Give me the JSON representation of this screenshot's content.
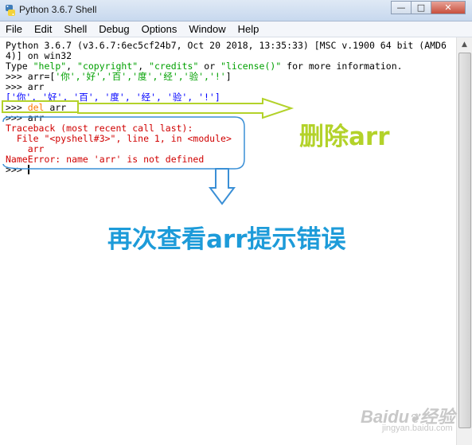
{
  "window": {
    "title": "Python 3.6.7 Shell"
  },
  "menu": [
    "File",
    "Edit",
    "Shell",
    "Debug",
    "Options",
    "Window",
    "Help"
  ],
  "shell": {
    "banner_1": "Python 3.6.7 (v3.6.7:6ec5cf24b7, Oct 20 2018, 13:35:33) [MSC v.1900 64 bit (AMD6",
    "banner_2": "4)] on win32",
    "banner_3_pre": "Type ",
    "banner_3_help": "\"help\"",
    "banner_3_sep1": ", ",
    "banner_3_copy": "\"copyright\"",
    "banner_3_sep2": ", ",
    "banner_3_cred": "\"credits\"",
    "banner_3_or": " or ",
    "banner_3_lic": "\"license()\"",
    "banner_3_post": " for more information.",
    "prompt": ">>> ",
    "cmd1_pre": "arr=[",
    "cmd1_list": "'你','好','百','度','经','验','!'",
    "cmd1_post": "]",
    "cmd2": "arr",
    "out2": "['你', '好', '百', '度', '经', '验', '!']",
    "cmd3_kw": "del",
    "cmd3_rest": " arr",
    "cmd4": "arr",
    "tb_1": "Traceback (most recent call last):",
    "tb_2": "  File \"<pyshell#3>\", line 1, in <module>",
    "tb_3": "    arr",
    "tb_4": "NameError: name 'arr' is not defined"
  },
  "annotations": {
    "delete_label": "删除arr",
    "error_label": "再次查看arr提示错误"
  },
  "watermark": {
    "brand": "Baidu",
    "suffix": "经验",
    "url": "jingyan.baidu.com"
  },
  "colors": {
    "green_arrow": "#b3d22a",
    "blue_callout": "#3a8fd6",
    "blue_label": "#1d9bd9"
  }
}
